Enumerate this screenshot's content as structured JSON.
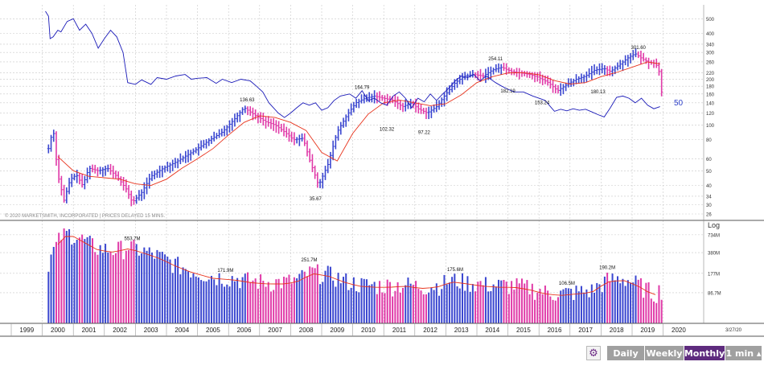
{
  "chart_data": [
    {
      "type": "ohlc",
      "name": "price",
      "scale": "log",
      "ylim": [
        26,
        560
      ],
      "y_tick_labels": [
        "500",
        "400",
        "340",
        "300",
        "260",
        "220",
        "200",
        "180",
        "160",
        "140",
        "120",
        "100",
        "80",
        "60",
        "50",
        "40",
        "34",
        "30",
        "26"
      ],
      "log_label": "Log",
      "copyright": "© 2020 MARKETSMITH, INCORPORATED | PRICES DELAYED 15 MINS.",
      "annotations": [
        {
          "label": "136.63",
          "x": 2006.6,
          "y": 136.63,
          "pos": "above"
        },
        {
          "label": "35.67",
          "x": 2008.8,
          "y": 35.67,
          "pos": "below"
        },
        {
          "label": "164.79",
          "x": 2010.3,
          "y": 164.79,
          "pos": "above"
        },
        {
          "label": "102.32",
          "x": 2011.1,
          "y": 102.32,
          "pos": "below"
        },
        {
          "label": "97.22",
          "x": 2012.3,
          "y": 97.22,
          "pos": "below"
        },
        {
          "label": "254.11",
          "x": 2014.6,
          "y": 254.11,
          "pos": "above"
        },
        {
          "label": "182.19",
          "x": 2015.0,
          "y": 182.19,
          "pos": "below"
        },
        {
          "label": "153.24",
          "x": 2016.1,
          "y": 153.24,
          "pos": "below"
        },
        {
          "label": "180.13",
          "x": 2017.9,
          "y": 180.13,
          "pos": "below"
        },
        {
          "label": "301.60",
          "x": 2019.2,
          "y": 301.6,
          "pos": "above"
        }
      ],
      "price_anchors": [
        [
          2000.2,
          70
        ],
        [
          2000.35,
          95
        ],
        [
          2000.5,
          47
        ],
        [
          2000.7,
          32
        ],
        [
          2000.9,
          44
        ],
        [
          2001.1,
          47
        ],
        [
          2001.3,
          40
        ],
        [
          2001.5,
          52
        ],
        [
          2001.8,
          50
        ],
        [
          2002.1,
          52
        ],
        [
          2002.4,
          46
        ],
        [
          2002.7,
          38
        ],
        [
          2002.9,
          31
        ],
        [
          2003.2,
          36
        ],
        [
          2003.5,
          46
        ],
        [
          2003.9,
          52
        ],
        [
          2004.3,
          57
        ],
        [
          2004.7,
          64
        ],
        [
          2005.0,
          70
        ],
        [
          2005.4,
          80
        ],
        [
          2005.8,
          90
        ],
        [
          2006.2,
          110
        ],
        [
          2006.5,
          130
        ],
        [
          2006.8,
          118
        ],
        [
          2007.2,
          105
        ],
        [
          2007.5,
          100
        ],
        [
          2007.8,
          90
        ],
        [
          2008.1,
          80
        ],
        [
          2008.4,
          82
        ],
        [
          2008.6,
          60
        ],
        [
          2008.9,
          40
        ],
        [
          2009.2,
          55
        ],
        [
          2009.5,
          90
        ],
        [
          2009.8,
          115
        ],
        [
          2010.1,
          140
        ],
        [
          2010.4,
          150
        ],
        [
          2010.7,
          155
        ],
        [
          2011.0,
          150
        ],
        [
          2011.3,
          145
        ],
        [
          2011.6,
          132
        ],
        [
          2011.9,
          140
        ],
        [
          2012.1,
          128
        ],
        [
          2012.4,
          120
        ],
        [
          2012.7,
          132
        ],
        [
          2013.0,
          160
        ],
        [
          2013.3,
          190
        ],
        [
          2013.6,
          210
        ],
        [
          2013.9,
          215
        ],
        [
          2014.2,
          210
        ],
        [
          2014.5,
          230
        ],
        [
          2014.8,
          240
        ],
        [
          2015.1,
          225
        ],
        [
          2015.4,
          220
        ],
        [
          2015.7,
          215
        ],
        [
          2016.0,
          205
        ],
        [
          2016.3,
          190
        ],
        [
          2016.6,
          168
        ],
        [
          2016.9,
          185
        ],
        [
          2017.2,
          200
        ],
        [
          2017.5,
          210
        ],
        [
          2017.8,
          230
        ],
        [
          2018.1,
          235
        ],
        [
          2018.3,
          225
        ],
        [
          2018.6,
          250
        ],
        [
          2018.9,
          280
        ],
        [
          2019.1,
          295
        ],
        [
          2019.3,
          275
        ],
        [
          2019.5,
          260
        ],
        [
          2019.7,
          255
        ],
        [
          2019.8,
          245
        ],
        [
          2019.85,
          240
        ],
        [
          2019.95,
          165
        ]
      ],
      "moving_average_anchors": [
        [
          2000.5,
          62
        ],
        [
          2001.0,
          50
        ],
        [
          2001.5,
          46
        ],
        [
          2002.0,
          45
        ],
        [
          2002.5,
          44
        ],
        [
          2003.0,
          41
        ],
        [
          2003.5,
          40
        ],
        [
          2004.0,
          44
        ],
        [
          2004.5,
          52
        ],
        [
          2005.0,
          60
        ],
        [
          2005.5,
          70
        ],
        [
          2006.0,
          86
        ],
        [
          2006.5,
          104
        ],
        [
          2007.0,
          115
        ],
        [
          2007.5,
          112
        ],
        [
          2008.0,
          104
        ],
        [
          2008.5,
          92
        ],
        [
          2009.0,
          66
        ],
        [
          2009.5,
          58
        ],
        [
          2010.0,
          88
        ],
        [
          2010.5,
          118
        ],
        [
          2011.0,
          140
        ],
        [
          2011.5,
          146
        ],
        [
          2012.0,
          140
        ],
        [
          2012.5,
          134
        ],
        [
          2013.0,
          138
        ],
        [
          2013.5,
          158
        ],
        [
          2014.0,
          190
        ],
        [
          2014.5,
          208
        ],
        [
          2015.0,
          220
        ],
        [
          2015.5,
          221
        ],
        [
          2016.0,
          214
        ],
        [
          2016.5,
          196
        ],
        [
          2017.0,
          186
        ],
        [
          2017.5,
          190
        ],
        [
          2018.0,
          208
        ],
        [
          2018.5,
          222
        ],
        [
          2019.0,
          240
        ],
        [
          2019.5,
          260
        ],
        [
          2019.9,
          252
        ]
      ],
      "relative_strength_line": [
        [
          2000.1,
          560
        ],
        [
          2000.2,
          520
        ],
        [
          2000.25,
          370
        ],
        [
          2000.35,
          380
        ],
        [
          2000.5,
          420
        ],
        [
          2000.6,
          410
        ],
        [
          2000.8,
          480
        ],
        [
          2001.0,
          500
        ],
        [
          2001.2,
          420
        ],
        [
          2001.4,
          460
        ],
        [
          2001.6,
          400
        ],
        [
          2001.8,
          320
        ],
        [
          2002.0,
          370
        ],
        [
          2002.2,
          420
        ],
        [
          2002.4,
          380
        ],
        [
          2002.6,
          300
        ],
        [
          2002.75,
          190
        ],
        [
          2003.0,
          185
        ],
        [
          2003.2,
          198
        ],
        [
          2003.5,
          185
        ],
        [
          2003.7,
          205
        ],
        [
          2004.0,
          200
        ],
        [
          2004.3,
          210
        ],
        [
          2004.6,
          215
        ],
        [
          2004.8,
          200
        ],
        [
          2005.0,
          203
        ],
        [
          2005.3,
          205
        ],
        [
          2005.6,
          188
        ],
        [
          2005.8,
          200
        ],
        [
          2006.1,
          190
        ],
        [
          2006.4,
          200
        ],
        [
          2006.7,
          195
        ],
        [
          2006.9,
          180
        ],
        [
          2007.1,
          165
        ],
        [
          2007.3,
          140
        ],
        [
          2007.6,
          120
        ],
        [
          2007.8,
          112
        ],
        [
          2008.0,
          120
        ],
        [
          2008.2,
          130
        ],
        [
          2008.4,
          140
        ],
        [
          2008.6,
          135
        ],
        [
          2008.8,
          140
        ],
        [
          2009.0,
          125
        ],
        [
          2009.2,
          130
        ],
        [
          2009.4,
          145
        ],
        [
          2009.6,
          155
        ],
        [
          2009.9,
          160
        ],
        [
          2010.1,
          150
        ],
        [
          2010.3,
          168
        ],
        [
          2010.5,
          145
        ],
        [
          2010.7,
          150
        ],
        [
          2010.9,
          140
        ],
        [
          2011.1,
          135
        ],
        [
          2011.3,
          155
        ],
        [
          2011.5,
          165
        ],
        [
          2011.7,
          150
        ],
        [
          2011.9,
          130
        ],
        [
          2012.1,
          150
        ],
        [
          2012.3,
          142
        ],
        [
          2012.5,
          160
        ],
        [
          2012.7,
          145
        ],
        [
          2012.9,
          160
        ],
        [
          2013.1,
          175
        ],
        [
          2013.3,
          195
        ],
        [
          2013.5,
          210
        ],
        [
          2013.7,
          205
        ],
        [
          2013.9,
          215
        ],
        [
          2014.1,
          195
        ],
        [
          2014.3,
          210
        ],
        [
          2014.6,
          190
        ],
        [
          2014.8,
          180
        ],
        [
          2015.0,
          172
        ],
        [
          2015.2,
          165
        ],
        [
          2015.5,
          165
        ],
        [
          2015.8,
          155
        ],
        [
          2016.0,
          150
        ],
        [
          2016.2,
          145
        ],
        [
          2016.4,
          130
        ],
        [
          2016.5,
          123
        ],
        [
          2016.7,
          127
        ],
        [
          2016.9,
          124
        ],
        [
          2017.1,
          128
        ],
        [
          2017.3,
          125
        ],
        [
          2017.5,
          127
        ],
        [
          2017.7,
          122
        ],
        [
          2017.9,
          117
        ],
        [
          2018.1,
          113
        ],
        [
          2018.3,
          130
        ],
        [
          2018.5,
          152
        ],
        [
          2018.7,
          155
        ],
        [
          2018.9,
          150
        ],
        [
          2019.1,
          140
        ],
        [
          2019.3,
          150
        ],
        [
          2019.5,
          135
        ],
        [
          2019.7,
          128
        ],
        [
          2019.9,
          132
        ]
      ],
      "relative_strength_label": "50",
      "colors": {
        "up": "#3a46d0",
        "down": "#e03aa8",
        "ma": "#e8331c",
        "rs": "#1a1ab8",
        "grid": "#c8c8c8"
      }
    },
    {
      "type": "bar",
      "name": "volume",
      "scale": "log",
      "y_tick_labels": [
        "734M",
        "380M",
        "177M",
        "86.7M"
      ],
      "annotations": [
        {
          "label": "553.7M",
          "x": 2002.9,
          "y": 553.7
        },
        {
          "label": "171.9M",
          "x": 2005.9,
          "y": 171.9
        },
        {
          "label": "251.7M",
          "x": 2008.6,
          "y": 251.7
        },
        {
          "label": "175.6M",
          "x": 2013.3,
          "y": 175.6
        },
        {
          "label": "106.5M",
          "x": 2016.9,
          "y": 106.5
        },
        {
          "label": "190.2M",
          "x": 2018.2,
          "y": 190.2
        }
      ],
      "volume_anchors": [
        [
          2000.2,
          280
        ],
        [
          2000.6,
          700
        ],
        [
          2000.9,
          800
        ],
        [
          2001.3,
          620
        ],
        [
          2001.8,
          450
        ],
        [
          2002.3,
          420
        ],
        [
          2002.8,
          480
        ],
        [
          2003.3,
          400
        ],
        [
          2003.8,
          330
        ],
        [
          2004.3,
          250
        ],
        [
          2004.8,
          200
        ],
        [
          2005.5,
          160
        ],
        [
          2006.2,
          150
        ],
        [
          2006.8,
          135
        ],
        [
          2007.3,
          130
        ],
        [
          2007.8,
          130
        ],
        [
          2008.2,
          140
        ],
        [
          2008.7,
          190
        ],
        [
          2009.2,
          175
        ],
        [
          2009.7,
          140
        ],
        [
          2010.2,
          120
        ],
        [
          2010.7,
          115
        ],
        [
          2011.2,
          115
        ],
        [
          2011.7,
          120
        ],
        [
          2012.2,
          110
        ],
        [
          2012.7,
          115
        ],
        [
          2013.2,
          140
        ],
        [
          2013.7,
          130
        ],
        [
          2014.2,
          120
        ],
        [
          2014.7,
          115
        ],
        [
          2015.2,
          115
        ],
        [
          2015.7,
          105
        ],
        [
          2016.2,
          90
        ],
        [
          2016.7,
          85
        ],
        [
          2017.2,
          90
        ],
        [
          2017.7,
          95
        ],
        [
          2018.2,
          140
        ],
        [
          2018.7,
          150
        ],
        [
          2019.2,
          120
        ],
        [
          2019.7,
          85
        ],
        [
          2019.95,
          100
        ]
      ]
    }
  ],
  "timeline": {
    "years": [
      "1999",
      "2000",
      "2001",
      "2002",
      "2003",
      "2004",
      "2005",
      "2006",
      "2007",
      "2008",
      "2009",
      "2010",
      "2011",
      "2012",
      "2013",
      "2014",
      "2015",
      "2016",
      "2017",
      "2018",
      "2019",
      "2020"
    ],
    "date_label": "3/27/20"
  },
  "toolbar": {
    "settings_icon": "gear-icon",
    "buttons": [
      "Daily",
      "Weekly",
      "Monthly",
      "1 min ▴"
    ],
    "active": "Monthly",
    "colors": {
      "active": "#5e2b7e",
      "inactive": "#a0a0a0"
    }
  }
}
